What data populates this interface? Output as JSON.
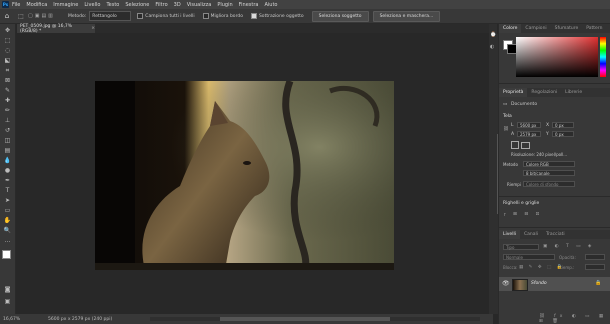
{
  "menu": {
    "logo": "Ps",
    "items": [
      "File",
      "Modifica",
      "Immagine",
      "Livello",
      "Testo",
      "Selezione",
      "Filtro",
      "3D",
      "Visualizza",
      "Plugin",
      "Finestra",
      "Aiuto"
    ]
  },
  "options": {
    "method_label": "Metodo:",
    "method_value": "Rettangolo",
    "sample_all_label": "Campiona tutti i livelli",
    "improve_edge_label": "Migliora bordo",
    "subtract_label": "Sottrazione oggetto",
    "select_subject_button": "Seleziona soggetto",
    "select_mask_button": "Seleziona e maschera..."
  },
  "document": {
    "tab_title": "PET_0509.jpg @ 16,7% (RGB/8) *",
    "close": "×"
  },
  "status": {
    "zoom": "16,67%",
    "info": "5600 px x 2579 px (240 ppi)"
  },
  "color_panel": {
    "tabs": [
      "Colore",
      "Campioni",
      "Sfumature",
      "Pattern"
    ],
    "active_tab": "Colore",
    "foreground": "#ffffff",
    "background": "#000000",
    "picker_hue": "#e03030"
  },
  "properties_panel": {
    "tabs": [
      "Proprietà",
      "Regolazioni",
      "Librerie"
    ],
    "active_tab": "Proprietà",
    "doc_label": "Documento",
    "canvas_title": "Tela",
    "w_label": "L",
    "w_value": "5600 px",
    "x_label": "X",
    "x_value": "0 px",
    "h_label": "A",
    "h_value": "2579 px",
    "y_label": "Y",
    "y_value": "0 px",
    "resolution": "Risoluzione: 240 pixel/poll...",
    "mode_label": "Metodo",
    "mode_value": "Colore RGB",
    "bits_value": "8 bit/canale",
    "fill_label": "Riempi",
    "fill_value": "Colore di sfondo",
    "rulers_title": "Righelli e griglie"
  },
  "layers_panel": {
    "tabs": [
      "Livelli",
      "Canali",
      "Tracciati"
    ],
    "active_tab": "Livelli",
    "search_placeholder": "Tipo",
    "blend_mode": "Normale",
    "opacity_label": "Opacità:",
    "lock_label": "Blocca:",
    "fill_label": "Riemp.:",
    "layer_name": "Sfondo"
  }
}
